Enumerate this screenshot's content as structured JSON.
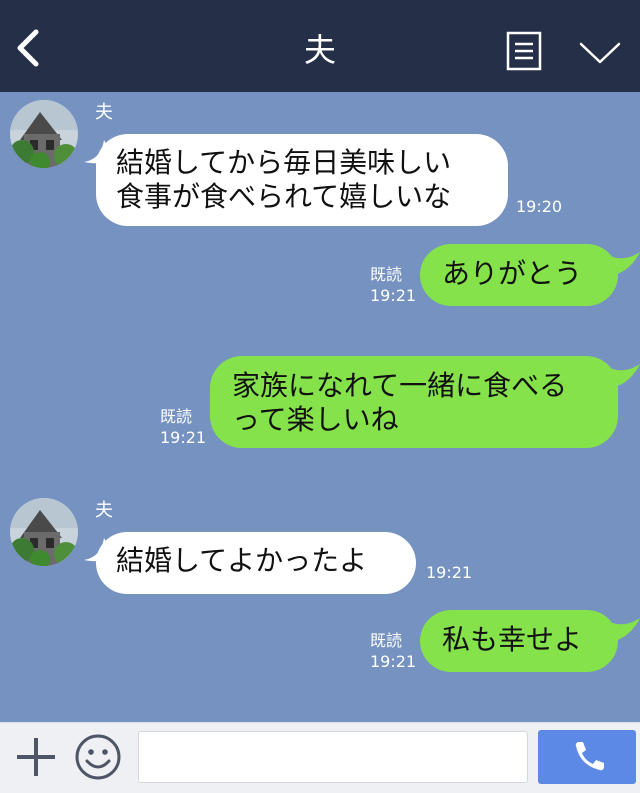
{
  "header": {
    "title": "夫"
  },
  "messages": [
    {
      "sender": "夫",
      "text": "結婚してから毎日美味しい\n食事が食べられて嬉しいな",
      "time": "19:20"
    },
    {
      "status": "既読",
      "time": "19:21",
      "text": "ありがとう"
    },
    {
      "status": "既読",
      "time": "19:21",
      "text": "家族になれて一緒に食べる\nって楽しいね"
    },
    {
      "sender": "夫",
      "text": "結婚してよかったよ",
      "time": "19:21"
    },
    {
      "status": "既読",
      "time": "19:21",
      "text": "私も幸せよ"
    }
  ],
  "footer": {
    "input_placeholder": ""
  },
  "icons": {
    "back": "back-chevron-icon",
    "menu": "menu-icon",
    "collapse": "chevron-down-icon",
    "add": "plus-icon",
    "emoji": "smiley-icon",
    "call": "phone-icon"
  },
  "colors": {
    "header": "#252f48",
    "background": "#7592c1",
    "incoming": "#ffffff",
    "outgoing": "#85e24b",
    "call_button": "#5b89e5"
  }
}
